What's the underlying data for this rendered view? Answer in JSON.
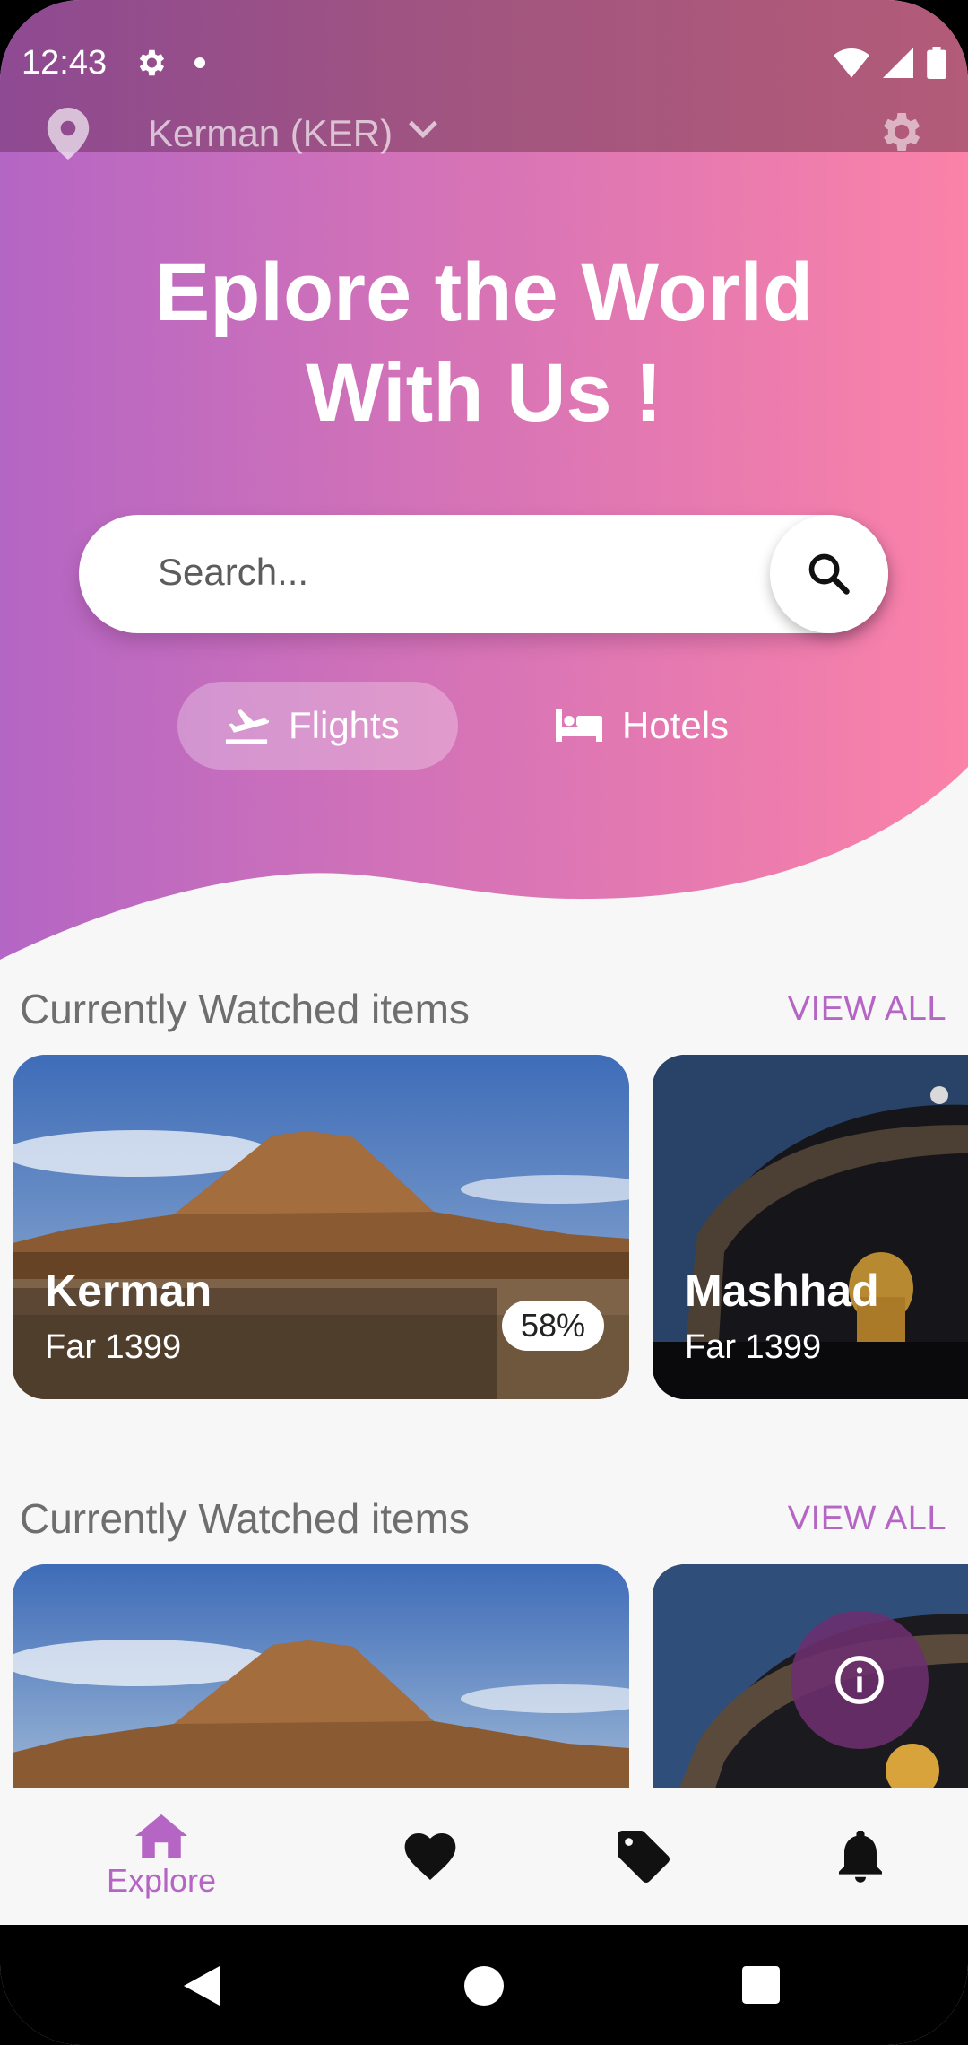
{
  "status_bar": {
    "time": "12:43"
  },
  "header": {
    "location": "Kerman (KER)"
  },
  "hero": {
    "title_line1": "Eplore the World",
    "title_line2": "With Us !",
    "search_placeholder": "Search..."
  },
  "tabs": [
    {
      "label": "Flights",
      "selected": true
    },
    {
      "label": "Hotels",
      "selected": false
    }
  ],
  "sections": [
    {
      "title": "Currently Watched items",
      "view_all": "VIEW ALL",
      "cards": [
        {
          "name": "Kerman",
          "date": "Far 1399",
          "badge": "58%"
        },
        {
          "name": "Mashhad",
          "date": "Far 1399"
        }
      ]
    },
    {
      "title": "Currently Watched items",
      "view_all": "VIEW ALL"
    }
  ],
  "bottom_nav": [
    {
      "label": "Explore",
      "icon": "home-icon",
      "active": true
    },
    {
      "icon": "heart-icon"
    },
    {
      "icon": "tag-icon"
    },
    {
      "icon": "bell-icon"
    }
  ],
  "colors": {
    "accent": "#b565c4",
    "gradient_start": "#b466c4",
    "gradient_end": "#fb82a8",
    "fab": "#6d2f70"
  }
}
